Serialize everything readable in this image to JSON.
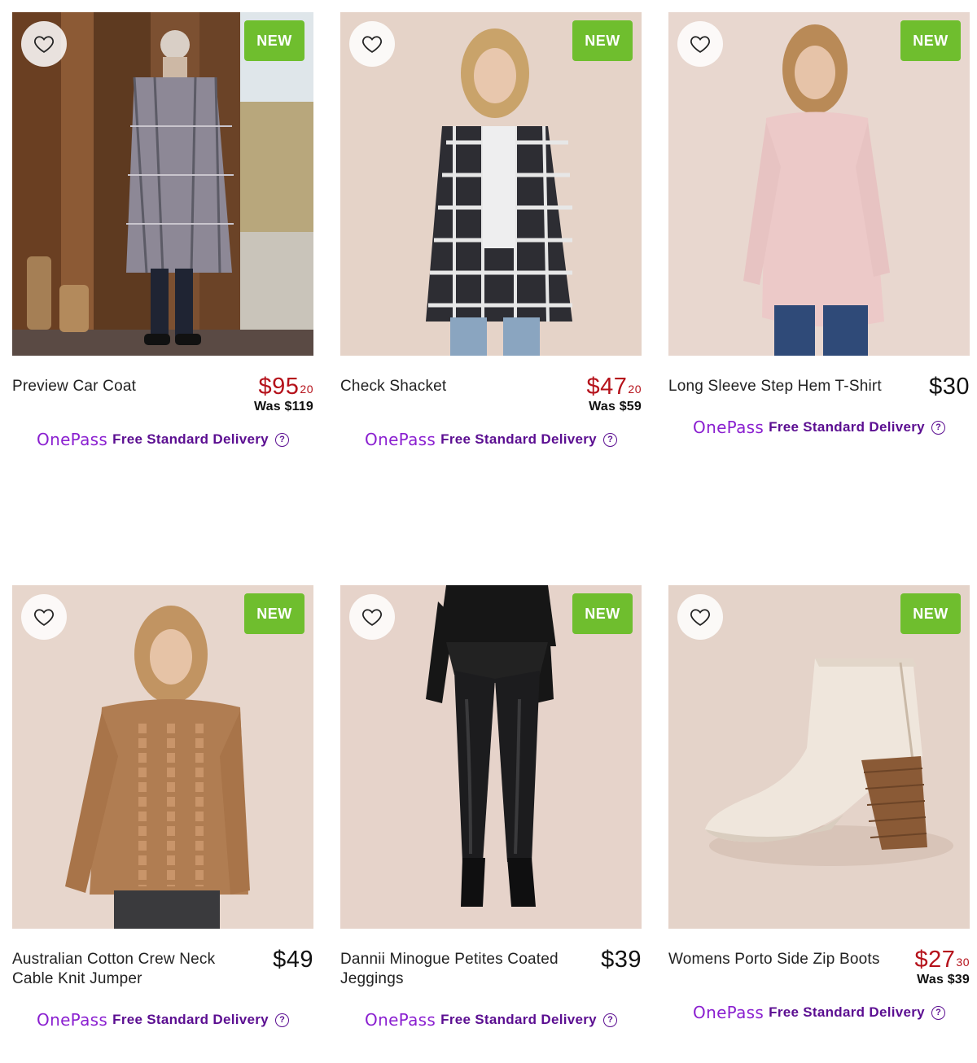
{
  "colors": {
    "sale_price": "#b5121b",
    "new_badge": "#6fbe2e",
    "onepass_purple": "#8a1fd0",
    "delivery_text": "#5b0e91"
  },
  "products": [
    {
      "title": "Preview Car Coat",
      "price_dollars": "$95",
      "price_cents": "20",
      "was": "Was $119",
      "on_sale": true,
      "badge": "NEW",
      "onepass": "OnePass",
      "delivery": "Free Standard Delivery",
      "help": "?",
      "image": "woman-in-plaid-coat"
    },
    {
      "title": "Check Shacket",
      "price_dollars": "$47",
      "price_cents": "20",
      "was": "Was $59",
      "on_sale": true,
      "badge": "NEW",
      "onepass": "OnePass",
      "delivery": "Free Standard Delivery",
      "help": "?",
      "image": "woman-in-check-shacket"
    },
    {
      "title": "Long Sleeve Step Hem T-Shirt",
      "price_dollars": "$30",
      "price_cents": "",
      "was": "",
      "on_sale": false,
      "badge": "NEW",
      "onepass": "OnePass",
      "delivery": "Free Standard Delivery",
      "help": "?",
      "image": "woman-in-pink-tshirt"
    },
    {
      "title": "Australian Cotton Crew Neck Cable Knit Jumper",
      "price_dollars": "$49",
      "price_cents": "",
      "was": "",
      "on_sale": false,
      "badge": "NEW",
      "onepass": "OnePass",
      "delivery": "Free Standard Delivery",
      "help": "?",
      "image": "woman-in-cable-knit-jumper"
    },
    {
      "title": "Dannii Minogue Petites Coated Jeggings",
      "price_dollars": "$39",
      "price_cents": "",
      "was": "",
      "on_sale": false,
      "badge": "NEW",
      "onepass": "OnePass",
      "delivery": "Free Standard Delivery",
      "help": "?",
      "image": "model-in-black-jeggings"
    },
    {
      "title": "Womens Porto Side Zip Boots",
      "price_dollars": "$27",
      "price_cents": "30",
      "was": "Was $39",
      "on_sale": true,
      "badge": "NEW",
      "onepass": "OnePass",
      "delivery": "Free Standard Delivery",
      "help": "?",
      "image": "cream-ankle-boot"
    }
  ]
}
